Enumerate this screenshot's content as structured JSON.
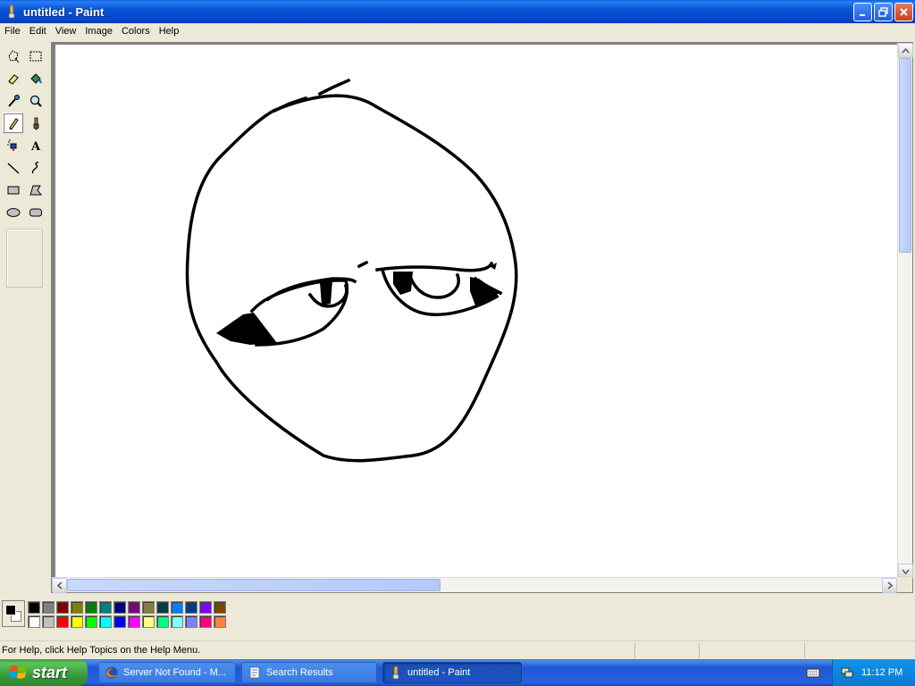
{
  "window": {
    "title": "untitled - Paint"
  },
  "menu": [
    "File",
    "Edit",
    "View",
    "Image",
    "Colors",
    "Help"
  ],
  "tools": [
    {
      "name": "free-form-select",
      "icon": "free-select-icon"
    },
    {
      "name": "select",
      "icon": "rect-select-icon"
    },
    {
      "name": "eraser",
      "icon": "eraser-icon"
    },
    {
      "name": "fill-with-color",
      "icon": "paint-bucket-icon"
    },
    {
      "name": "pick-color",
      "icon": "eyedropper-icon"
    },
    {
      "name": "magnifier",
      "icon": "magnifier-icon"
    },
    {
      "name": "pencil",
      "icon": "pencil-icon",
      "selected": true
    },
    {
      "name": "brush",
      "icon": "brush-icon"
    },
    {
      "name": "airbrush",
      "icon": "airbrush-icon"
    },
    {
      "name": "text",
      "icon": "text-icon"
    },
    {
      "name": "line",
      "icon": "line-icon"
    },
    {
      "name": "curve",
      "icon": "curve-icon"
    },
    {
      "name": "rectangle",
      "icon": "rectangle-icon"
    },
    {
      "name": "polygon",
      "icon": "polygon-icon"
    },
    {
      "name": "ellipse",
      "icon": "ellipse-icon"
    },
    {
      "name": "rounded-rectangle",
      "icon": "rounded-rect-icon"
    }
  ],
  "palette": {
    "foreground": "#000000",
    "background": "#ffffff",
    "top_row": [
      "#000000",
      "#808080",
      "#800000",
      "#808000",
      "#008000",
      "#008080",
      "#000080",
      "#800080",
      "#808040",
      "#004040",
      "#0080ff",
      "#004080",
      "#8000ff",
      "#804000"
    ],
    "bottom_row": [
      "#ffffff",
      "#c0c0c0",
      "#ff0000",
      "#ffff00",
      "#00ff00",
      "#00ffff",
      "#0000ff",
      "#ff00ff",
      "#ffff80",
      "#00ff80",
      "#80ffff",
      "#8080ff",
      "#ff0080",
      "#ff8040"
    ]
  },
  "status": {
    "help_text": "For Help, click Help Topics on the Help Menu."
  },
  "taskbar": {
    "start_label": "start",
    "tasks": [
      {
        "label": "Server Not Found - M...",
        "icon": "firefox-icon",
        "active": false
      },
      {
        "label": "Search Results",
        "icon": "search-results-icon",
        "active": false
      },
      {
        "label": "untitled - Paint",
        "icon": "paint-icon",
        "active": true
      }
    ],
    "clock": "11:12 PM"
  }
}
